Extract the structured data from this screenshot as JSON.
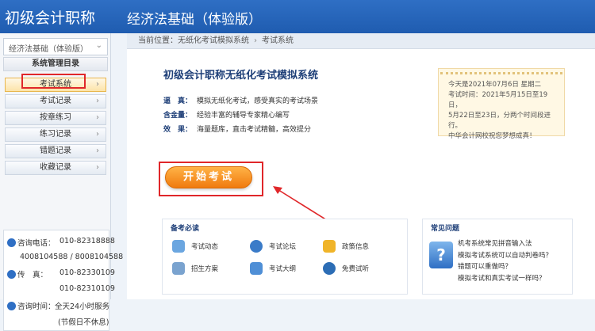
{
  "header": {
    "app_title": "初级会计职称",
    "subject_title": "经济法基础（体验版）"
  },
  "sidebar": {
    "subject_select": "经济法基础（体验版）",
    "menu_title": "系统管理目录",
    "items": [
      {
        "label": "考试系统"
      },
      {
        "label": "考试记录"
      },
      {
        "label": "按章练习"
      },
      {
        "label": "练习记录"
      },
      {
        "label": "错题记录"
      },
      {
        "label": "收藏记录"
      }
    ],
    "contact": {
      "phone_label": "咨询电话：",
      "phone1": "010-82318888",
      "phone2": "4008104588 / 8008104588",
      "fax_label": "传　真：",
      "fax1": "010-82330109",
      "fax2": "010-82310109",
      "hours_label": "咨询时间：",
      "hours": "全天24小时服务",
      "holiday": "(节假日不休息)"
    }
  },
  "breadcrumb": {
    "prefix": "当前位置：",
    "level1": "无纸化考试模拟系统",
    "level2": "考试系统"
  },
  "main": {
    "title": "初级会计职称无纸化考试模拟系统",
    "features": [
      {
        "key": "逼　真：",
        "text": "模拟无纸化考试，感受真实的考试场景"
      },
      {
        "key": "含金量：",
        "text": "经验丰富的辅导专家精心编写"
      },
      {
        "key": "效　果：",
        "text": "海量题库，直击考试精髓，高效提分"
      }
    ],
    "note": {
      "line1": "今天是2021年07月6日 星期二",
      "line2": "考试时间：2021年5月15日至19日，",
      "line3": "5月22日至23日，分两个时间段进行。",
      "line4": "中华会计网校祝您梦想成真！"
    },
    "start_button": "开始考试"
  },
  "prep": {
    "title": "备考必读",
    "items": [
      {
        "label": "考试动态"
      },
      {
        "label": "考试论坛"
      },
      {
        "label": "政策信息"
      },
      {
        "label": "招生方案"
      },
      {
        "label": "考试大纲"
      },
      {
        "label": "免费试听"
      }
    ]
  },
  "faq": {
    "title": "常见问题",
    "icon_glyph": "?",
    "items": [
      "机考系统常见拼音输入法",
      "模拟考试系统可以自动判卷吗？",
      "错题可以重做吗？",
      "模拟考试和真实考试一样吗？"
    ]
  },
  "colors": {
    "header": "#2f6fc4",
    "accent_orange": "#f07a0e",
    "highlight_red": "#e0272a"
  }
}
